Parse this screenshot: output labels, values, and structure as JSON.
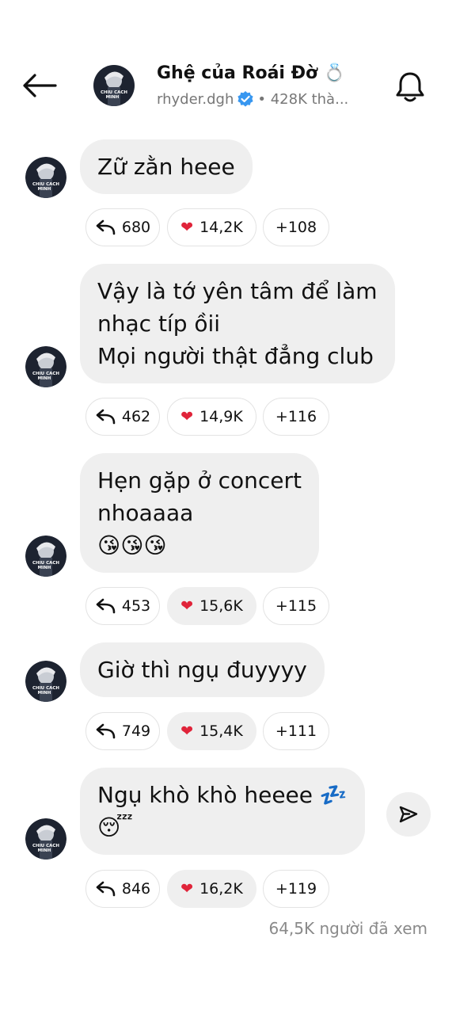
{
  "header": {
    "title": "Ghệ của Roái Đờ 💍",
    "handle": "rhyder.dgh",
    "followers": "• 428K thà..."
  },
  "avatar_text": [
    "CHIU CACH",
    "MINH"
  ],
  "messages": [
    {
      "lines": [
        "Zữ zằn heee"
      ],
      "reply_count": "680",
      "like_count": "14,2K",
      "reactions_more": "+108"
    },
    {
      "lines": [
        "Vậy là tớ yên tâm để làm",
        "nhạc típ ồii",
        "Mọi người thật đẳng club"
      ],
      "reply_count": "462",
      "like_count": "14,9K",
      "reactions_more": "+116"
    },
    {
      "lines": [
        "Hẹn gặp ở concert",
        "nhoaaaa",
        "😘😘😘"
      ],
      "reply_count": "453",
      "like_count": "15,6K",
      "reactions_more": "+115"
    },
    {
      "lines": [
        "Giờ thì ngụ đuyyyy"
      ],
      "reply_count": "749",
      "like_count": "15,4K",
      "reactions_more": "+111"
    },
    {
      "lines": [
        "Ngụ khò khò heeee 💤",
        "😴"
      ],
      "reply_count": "846",
      "like_count": "16,2K",
      "reactions_more": "+119"
    }
  ],
  "views": "64,5K người đã xem",
  "icons": {
    "back": "arrow-left-icon",
    "bell": "bell-icon",
    "reply": "reply-arrow-icon",
    "heart": "heart-icon",
    "send": "send-icon",
    "verified": "verified-badge-icon"
  },
  "colors": {
    "bubble": "#efefef",
    "heart": "#e0243a",
    "verified": "#3897f0",
    "muted": "#8a8a8a"
  }
}
